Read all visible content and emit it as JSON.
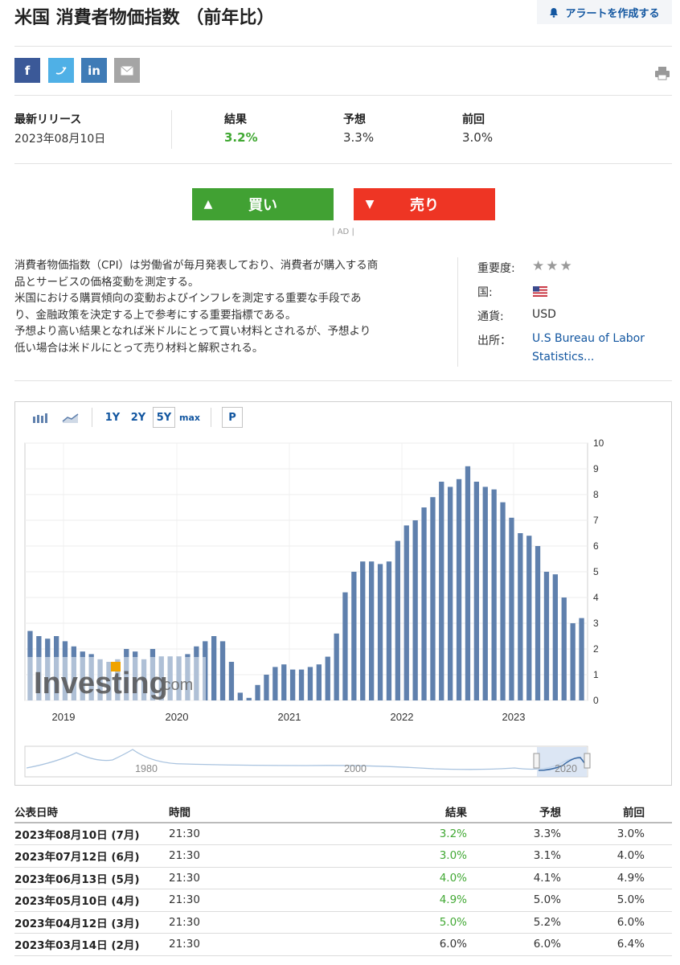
{
  "header": {
    "title": "米国 消費者物価指数 （前年比）",
    "alert_label": "アラートを作成する"
  },
  "share": {
    "facebook": "f",
    "twitter": "",
    "linkedin": "in"
  },
  "release": {
    "latest_label": "最新リリース",
    "latest_date": "2023年08月10日",
    "actual_label": "結果",
    "actual": "3.2%",
    "forecast_label": "予想",
    "forecast": "3.3%",
    "previous_label": "前回",
    "previous": "3.0%"
  },
  "trade": {
    "buy_label": "買い",
    "sell_label": "売り",
    "ad_label": "| AD |"
  },
  "description": [
    "消費者物価指数（CPI）は労働省が毎月発表しており、消費者が購入する商",
    "品とサービスの価格変動を測定する。",
    "米国における購買傾向の変動およびインフレを測定する重要な手段であ",
    "り、金融政策を決定する上で参考にする重要指標である。",
    "予想より高い結果となれば米ドルにとって買い材料とされるが、予想より",
    "低い場合は米ドルにとって売り材料と解釈される。"
  ],
  "meta": {
    "importance_label": "重要度:",
    "importance_stars": "★★★",
    "country_label": "国:",
    "currency_label": "通貨:",
    "currency": "USD",
    "source_label": "出所：",
    "source_line1": "U.S Bureau of Labor",
    "source_line2": "Statistics..."
  },
  "toolbar": {
    "r1y": "1Y",
    "r2y": "2Y",
    "r5y": "5Y",
    "rmax": "max",
    "p": "P"
  },
  "colors": {
    "bar": "#5f80ad",
    "buy": "#41a133",
    "sell": "#ee3524",
    "link": "#1256a0",
    "up": "#41a833"
  },
  "chart_data": {
    "type": "bar",
    "ylim": [
      0,
      10
    ],
    "yticks": [
      "0",
      "1",
      "2",
      "3",
      "4",
      "5",
      "6",
      "7",
      "8",
      "9",
      "10"
    ],
    "xtick_labels": [
      "2019",
      "2020",
      "2021",
      "2022",
      "2023"
    ],
    "grid": true,
    "watermark": "Investing.com",
    "values": [
      2.7,
      2.5,
      2.4,
      2.5,
      2.3,
      2.1,
      1.9,
      1.8,
      1.6,
      1.5,
      1.6,
      2.0,
      1.9,
      1.6,
      2.0,
      1.7,
      1.7,
      1.7,
      1.8,
      2.1,
      2.3,
      2.5,
      2.3,
      1.5,
      0.3,
      0.1,
      0.6,
      1.0,
      1.3,
      1.4,
      1.2,
      1.2,
      1.3,
      1.4,
      1.7,
      2.6,
      4.2,
      5.0,
      5.4,
      5.4,
      5.3,
      5.4,
      6.2,
      6.8,
      7.0,
      7.5,
      7.9,
      8.5,
      8.3,
      8.6,
      9.1,
      8.5,
      8.3,
      8.2,
      7.7,
      7.1,
      6.5,
      6.4,
      6.0,
      5.0,
      4.9,
      4.0,
      3.0,
      3.2
    ],
    "navigator_labels": [
      "1980",
      "2000",
      "2020"
    ]
  },
  "table": {
    "headers": {
      "date": "公表日時",
      "time": "時間",
      "actual": "結果",
      "forecast": "予想",
      "previous": "前回"
    },
    "rows": [
      {
        "date": "2023年08月10日 (7月)",
        "time": "21:30",
        "actual": "3.2%",
        "forecast": "3.3%",
        "previous": "3.0%"
      },
      {
        "date": "2023年07月12日 (6月)",
        "time": "21:30",
        "actual": "3.0%",
        "forecast": "3.1%",
        "previous": "4.0%"
      },
      {
        "date": "2023年06月13日 (5月)",
        "time": "21:30",
        "actual": "4.0%",
        "forecast": "4.1%",
        "previous": "4.9%"
      },
      {
        "date": "2023年05月10日 (4月)",
        "time": "21:30",
        "actual": "4.9%",
        "forecast": "5.0%",
        "previous": "5.0%"
      },
      {
        "date": "2023年04月12日 (3月)",
        "time": "21:30",
        "actual": "5.0%",
        "forecast": "5.2%",
        "previous": "6.0%"
      },
      {
        "date": "2023年03月14日 (2月)",
        "time": "21:30",
        "actual": "6.0%",
        "forecast": "6.0%",
        "previous": "6.4%"
      }
    ]
  }
}
